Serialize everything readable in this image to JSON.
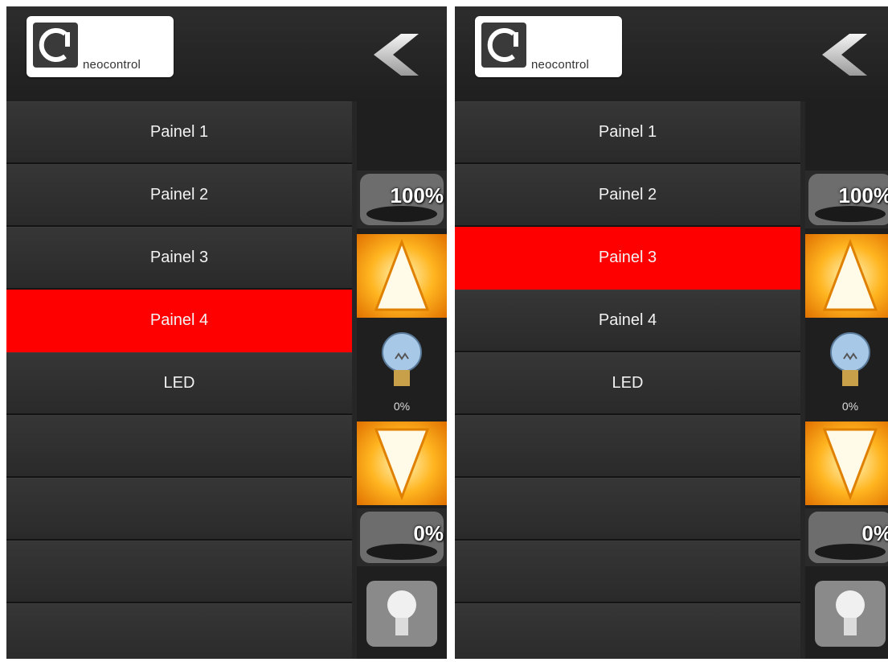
{
  "brand": {
    "logo_text": "neocontrol"
  },
  "screens": [
    {
      "panels": [
        "Painel 1",
        "Painel 2",
        "Painel 3",
        "Painel 4",
        "LED",
        "",
        "",
        "",
        ""
      ],
      "selected_index": 3,
      "dimmer": {
        "max_label": "100%",
        "level_label": "0%",
        "min_label": "0%"
      }
    },
    {
      "panels": [
        "Painel 1",
        "Painel 2",
        "Painel 3",
        "Painel 4",
        "LED",
        "",
        "",
        "",
        ""
      ],
      "selected_index": 2,
      "dimmer": {
        "max_label": "100%",
        "level_label": "0%",
        "min_label": "0%"
      }
    }
  ],
  "colors": {
    "selected": "#ff0000",
    "background": "#262626",
    "accent": "#ffb520"
  }
}
